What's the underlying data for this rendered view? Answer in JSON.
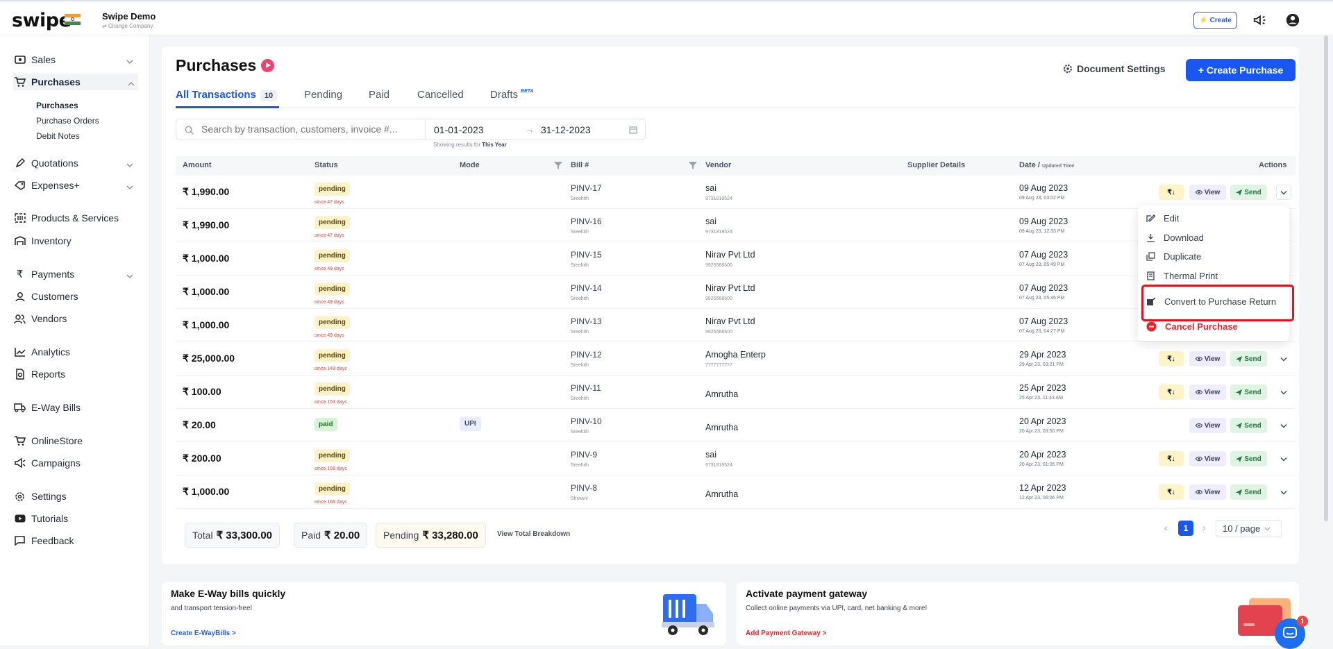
{
  "app": {
    "logo": "swipe",
    "company_name": "Swipe Demo",
    "change_company": "⇄ Change Company",
    "create_label": "Create"
  },
  "sidebar": {
    "items": [
      {
        "label": "Sales"
      },
      {
        "label": "Purchases"
      },
      {
        "label": "Quotations"
      },
      {
        "label": "Expenses+"
      },
      {
        "label": "Products & Services"
      },
      {
        "label": "Inventory"
      },
      {
        "label": "Payments"
      },
      {
        "label": "Customers"
      },
      {
        "label": "Vendors"
      },
      {
        "label": "Analytics"
      },
      {
        "label": "Reports"
      },
      {
        "label": "E-Way Bills"
      },
      {
        "label": "OnlineStore"
      },
      {
        "label": "Campaigns"
      },
      {
        "label": "Settings"
      },
      {
        "label": "Tutorials"
      },
      {
        "label": "Feedback"
      }
    ],
    "purchase_sub": [
      "Purchases",
      "Purchase Orders",
      "Debit Notes"
    ]
  },
  "page": {
    "title": "Purchases",
    "document_settings": "Document Settings",
    "create_purchase": "+ Create Purchase",
    "tabs": [
      {
        "label": "All Transactions",
        "count": "10"
      },
      {
        "label": "Pending"
      },
      {
        "label": "Paid"
      },
      {
        "label": "Cancelled"
      },
      {
        "label": "Drafts",
        "badge": "BETA"
      }
    ],
    "search_placeholder": "Search by transaction, customers, invoice #...",
    "date_from": "01-01-2023",
    "date_to": "31-12-2023",
    "showing_prefix": "Showing results for",
    "showing_period": "This Year"
  },
  "table": {
    "headers": [
      "Amount",
      "Status",
      "Mode",
      "Bill #",
      "Vendor",
      "Supplier Details",
      "Date /",
      "Updated Time",
      "Actions"
    ],
    "rows": [
      {
        "amount": "₹ 1,990.00",
        "status": "pending",
        "since": "since 47 days",
        "mode": "",
        "bill": "PINV-17",
        "bill_by": "Sreehith",
        "vendor": "sai",
        "vendor_phone": "9731819524",
        "date": "09 Aug 2023",
        "updated": "09 Aug 23, 03:02 PM"
      },
      {
        "amount": "₹ 1,990.00",
        "status": "pending",
        "since": "since 47 days",
        "mode": "",
        "bill": "PINV-16",
        "bill_by": "Sreehith",
        "vendor": "sai",
        "vendor_phone": "9731819524",
        "date": "09 Aug 2023",
        "updated": "09 Aug 23, 12:33 PM"
      },
      {
        "amount": "₹ 1,000.00",
        "status": "pending",
        "since": "since 49 days",
        "mode": "",
        "bill": "PINV-15",
        "bill_by": "Sreehith",
        "vendor": "Nirav Pvt Ltd",
        "vendor_phone": "9925568500",
        "date": "07 Aug 2023",
        "updated": "07 Aug 23, 05:49 PM"
      },
      {
        "amount": "₹ 1,000.00",
        "status": "pending",
        "since": "since 49 days",
        "mode": "",
        "bill": "PINV-14",
        "bill_by": "Sreehith",
        "vendor": "Nirav Pvt Ltd",
        "vendor_phone": "9925568500",
        "date": "07 Aug 2023",
        "updated": "07 Aug 23, 05:46 PM"
      },
      {
        "amount": "₹ 1,000.00",
        "status": "pending",
        "since": "since 49 days",
        "mode": "",
        "bill": "PINV-13",
        "bill_by": "Sreehith",
        "vendor": "Nirav Pvt Ltd",
        "vendor_phone": "9925568500",
        "date": "07 Aug 2023",
        "updated": "07 Aug 23, 04:27 PM"
      },
      {
        "amount": "₹ 25,000.00",
        "status": "pending",
        "since": "since 149 days",
        "mode": "",
        "bill": "PINV-12",
        "bill_by": "Sreehith",
        "vendor": "Amogha Enterp",
        "vendor_phone": "7777777777",
        "date": "29 Apr 2023",
        "updated": "29 Apr 23, 03:21 PM"
      },
      {
        "amount": "₹ 100.00",
        "status": "pending",
        "since": "since 153 days",
        "mode": "",
        "bill": "PINV-11",
        "bill_by": "Sreehith",
        "vendor": "Amrutha",
        "vendor_phone": "",
        "date": "25 Apr 2023",
        "updated": "25 Apr 23, 11:43 AM"
      },
      {
        "amount": "₹ 20.00",
        "status": "paid",
        "since": "",
        "mode": "UPI",
        "bill": "PINV-10",
        "bill_by": "Sreehith",
        "vendor": "Amrutha",
        "vendor_phone": "",
        "date": "20 Apr 2023",
        "updated": "20 Apr 23, 03:50 PM"
      },
      {
        "amount": "₹ 200.00",
        "status": "pending",
        "since": "since 158 days",
        "mode": "",
        "bill": "PINV-9",
        "bill_by": "Sreehith",
        "vendor": "sai",
        "vendor_phone": "9731819524",
        "date": "20 Apr 2023",
        "updated": "20 Apr 23, 01:06 PM"
      },
      {
        "amount": "₹ 1,000.00",
        "status": "pending",
        "since": "since 166 days",
        "mode": "",
        "bill": "PINV-8",
        "bill_by": "Shiwani",
        "vendor": "Amrutha",
        "vendor_phone": "",
        "date": "12 Apr 2023",
        "updated": "12 Apr 23, 06:06 PM"
      }
    ],
    "actions": {
      "view": "View",
      "send": "Send",
      "rupee": "₹↓"
    }
  },
  "dropdown": {
    "items": [
      "Edit",
      "Download",
      "Duplicate",
      "Thermal Print",
      "Convert to Purchase Return",
      "Cancel Purchase"
    ]
  },
  "totals": {
    "total_label": "Total",
    "total_value": "₹ 33,300.00",
    "paid_label": "Paid",
    "paid_value": "₹ 20.00",
    "pending_label": "Pending",
    "pending_value": "₹ 33,280.00",
    "breakdown": "View Total Breakdown"
  },
  "pagination": {
    "current": "1",
    "per_page": "10 / page"
  },
  "cards": {
    "eway": {
      "title": "Make E-Way bills quickly",
      "desc": "and transport tension-free!",
      "link": "Create E-WayBills >"
    },
    "gateway": {
      "title": "Activate payment gateway",
      "desc": "Collect online payments via UPI, card, net banking & more!",
      "link": "Add Payment Gateway >"
    }
  },
  "chat_badge": "1",
  "colors": {
    "accent": "#1a56f0",
    "pending": "#fdf3c9",
    "paid": "#d8f4d6",
    "danger": "#e0262e"
  }
}
